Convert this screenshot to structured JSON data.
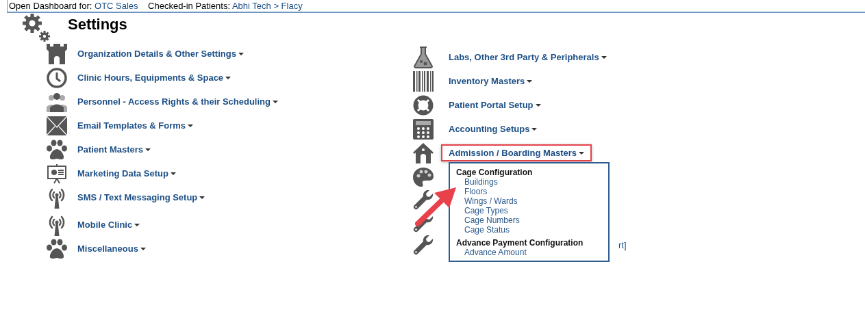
{
  "top_bar": {
    "dashboard_label": "Open Dashboard for:",
    "dashboard_value": "OTC Sales",
    "patients_label": "Checked-in Patients:",
    "patients_value": "Abhi Tech > Flacy"
  },
  "title": "Settings",
  "left_items": [
    {
      "kind": "tower",
      "label": "Organization Details & Other Settings"
    },
    {
      "kind": "clock",
      "label": "Clinic Hours, Equipments & Space"
    },
    {
      "kind": "people",
      "label": "Personnel - Access Rights & their Scheduling"
    },
    {
      "kind": "envelope",
      "label": "Email Templates & Forms"
    },
    {
      "kind": "paw",
      "label": "Patient Masters"
    },
    {
      "kind": "presentation",
      "label": "Marketing Data Setup"
    },
    {
      "kind": "antenna",
      "label": "SMS / Text Messaging Setup"
    },
    {
      "kind": "antenna",
      "label": "Mobile Clinic"
    },
    {
      "kind": "paw",
      "label": "Miscellaneous"
    }
  ],
  "right_items": [
    {
      "kind": "flask",
      "label": "Labs, Other 3rd Party & Peripherals",
      "highlighted": false
    },
    {
      "kind": "barcode",
      "label": "Inventory Masters",
      "highlighted": false
    },
    {
      "kind": "lifebuoy",
      "label": "Patient Portal Setup",
      "highlighted": false
    },
    {
      "kind": "calculator",
      "label": "Accounting Setups",
      "highlighted": false
    },
    {
      "kind": "doghouse",
      "label": "Admission / Boarding Masters",
      "highlighted": true,
      "menu": [
        {
          "kind": "heading",
          "label": "Cage Configuration"
        },
        {
          "kind": "link",
          "label": "Buildings"
        },
        {
          "kind": "link",
          "label": "Floors"
        },
        {
          "kind": "link",
          "label": "Wings / Wards"
        },
        {
          "kind": "link",
          "label": "Cage Types"
        },
        {
          "kind": "link",
          "label": "Cage Numbers"
        },
        {
          "kind": "link",
          "label": "Cage Status"
        },
        {
          "kind": "heading",
          "label": "Advance Payment Configuration"
        },
        {
          "kind": "link",
          "label": "Advance Amount"
        }
      ]
    },
    {
      "kind": "palette"
    },
    {
      "kind": "wrench"
    },
    {
      "kind": "wrench"
    },
    {
      "kind": "wrench",
      "partial_label": "rt]"
    }
  ],
  "callout_arrow": true
}
